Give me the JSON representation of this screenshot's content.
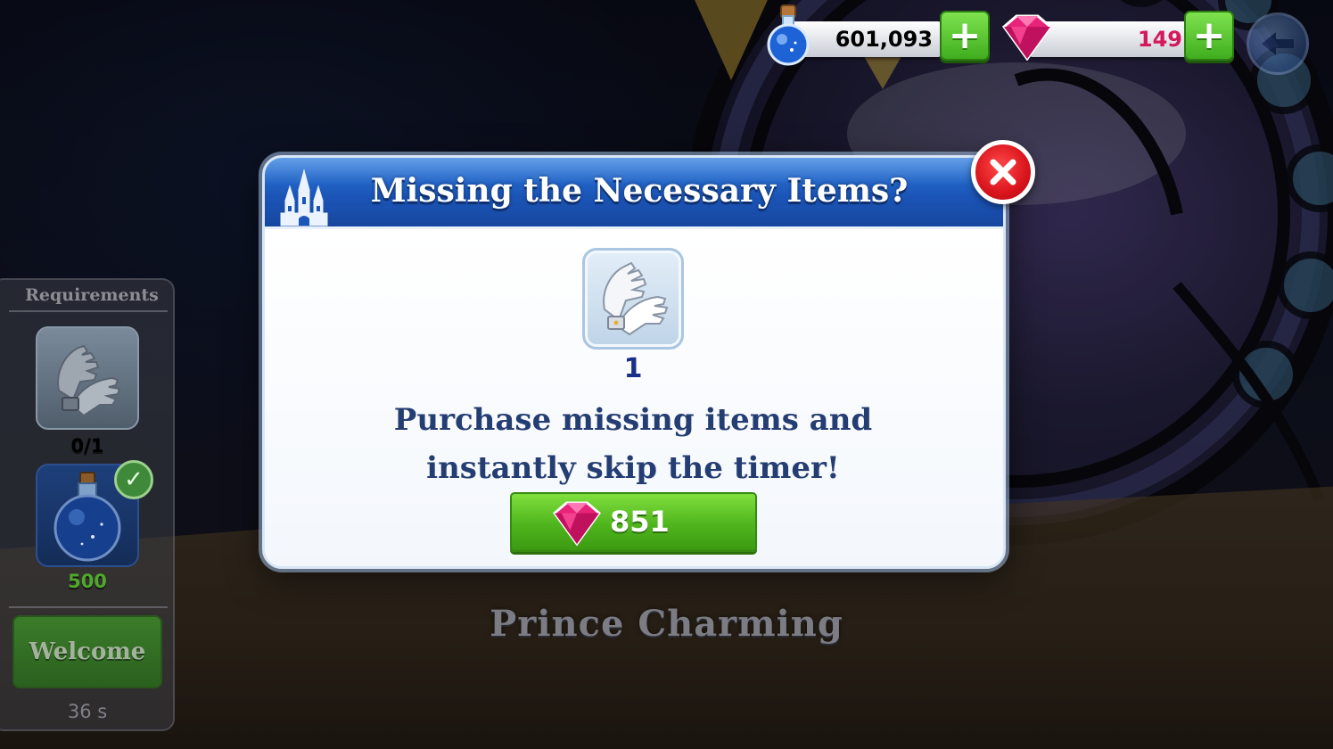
{
  "currencies": {
    "potions": {
      "value": "601,093",
      "icon": "blue-potion-icon",
      "color": "#1f2c5c"
    },
    "gems": {
      "value": "149",
      "icon": "pink-gem-icon",
      "color": "#d4185c"
    }
  },
  "requirements": {
    "title": "Requirements",
    "items": [
      {
        "icon": "white-gloves-icon",
        "count": "0/1",
        "count_color": "#ffffff"
      },
      {
        "icon": "blue-potion-icon",
        "count": "500",
        "count_color": "#5fc23a",
        "fulfilled": true
      }
    ],
    "welcome_label": "Welcome",
    "timer": "36 s"
  },
  "scene_title": "Prince Charming",
  "modal": {
    "title": "Missing the Necessary Items?",
    "item": {
      "icon": "white-gloves-icon",
      "quantity": "1"
    },
    "message_line1": "Purchase missing items and",
    "message_line2": "instantly skip the timer!",
    "price": "851",
    "accent": "#1b55b8",
    "button_color": "#4fb51d"
  }
}
